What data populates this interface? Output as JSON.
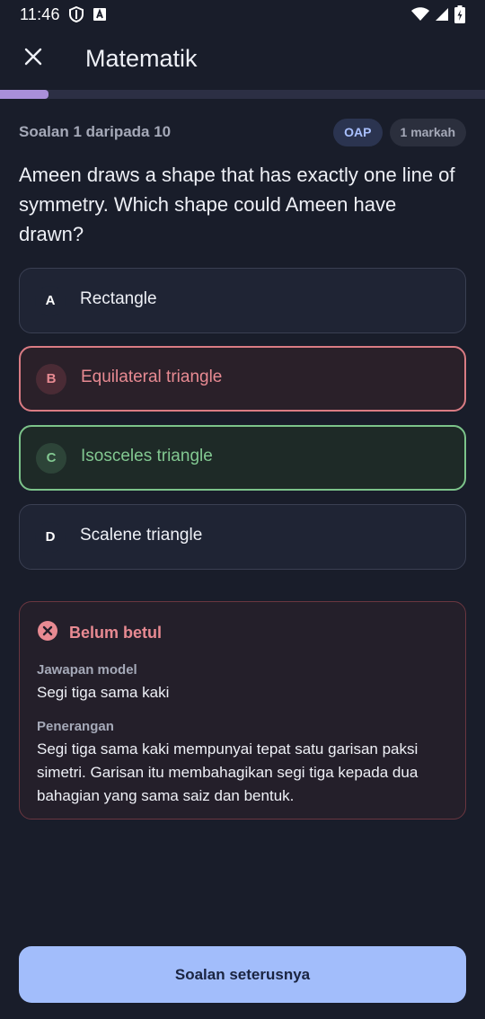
{
  "status_bar": {
    "time": "11:46",
    "icons_left": [
      "shield-icon",
      "font-a-icon"
    ],
    "icons_right": [
      "wifi-icon",
      "signal-icon",
      "battery-charging-icon"
    ]
  },
  "app_bar": {
    "close_icon": "close-icon",
    "title": "Matematik"
  },
  "progress": {
    "current": 1,
    "total": 10,
    "fraction": 0.1,
    "color": "#a98fd9"
  },
  "meta": {
    "question_counter": "Soalan 1 daripada 10",
    "chip_category": "OAP",
    "chip_marks": "1 markah"
  },
  "question": {
    "text": "Ameen draws a shape that has exactly one line of symmetry. Which shape could Ameen have drawn?"
  },
  "options": [
    {
      "letter": "A",
      "text": "Rectangle",
      "state": "neutral"
    },
    {
      "letter": "B",
      "text": "Equilateral triangle",
      "state": "wrong"
    },
    {
      "letter": "C",
      "text": "Isosceles triangle",
      "state": "correct"
    },
    {
      "letter": "D",
      "text": "Scalene triangle",
      "state": "neutral"
    }
  ],
  "feedback": {
    "icon": "error-circle-icon",
    "title": "Belum betul",
    "model_answer_label": "Jawapan model",
    "model_answer": "Segi tiga sama kaki",
    "explanation_label": "Penerangan",
    "explanation": "Segi tiga sama kaki mempunyai tepat satu garisan paksi simetri. Garisan itu membahagikan segi tiga kepada dua bahagian yang sama saiz dan bentuk."
  },
  "next_button": {
    "label": "Soalan seterusnya"
  },
  "colors": {
    "background": "#191d2a",
    "accent": "#a2bdfb",
    "wrong": "#e88a92",
    "correct": "#82c891"
  }
}
